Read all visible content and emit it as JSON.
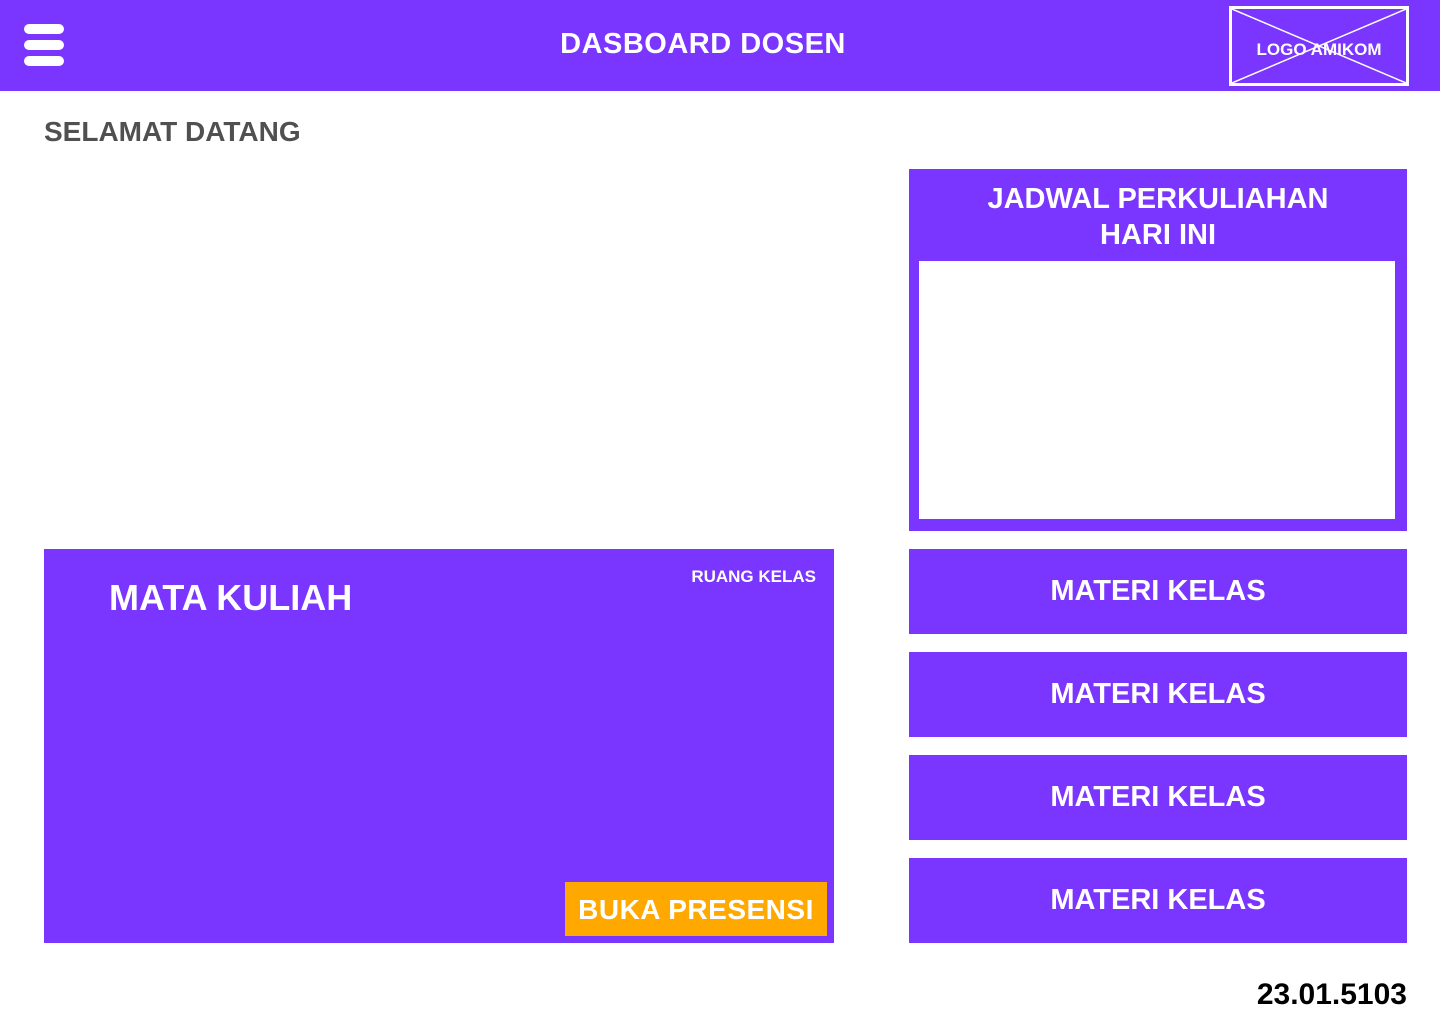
{
  "header": {
    "title": "DASBOARD DOSEN",
    "menu_icon": "hamburger-menu-icon",
    "logo_text": "LOGO AMIKOM"
  },
  "welcome": "SELAMAT DATANG",
  "schedule": {
    "title_line1": "JADWAL PERKULIAHAN",
    "title_line2": "HARI INI"
  },
  "course": {
    "title": "MATA KULIAH",
    "room_label": "RUANG KELAS",
    "presensi_button": "BUKA PRESENSI"
  },
  "materials": [
    {
      "label": "MATERI KELAS"
    },
    {
      "label": "MATERI KELAS"
    },
    {
      "label": "MATERI KELAS"
    },
    {
      "label": "MATERI KELAS"
    }
  ],
  "footer": {
    "id_text": "23.01.5103"
  },
  "colors": {
    "primary": "#7a36ff",
    "accent": "#ffa800",
    "welcome_text": "#505050"
  }
}
